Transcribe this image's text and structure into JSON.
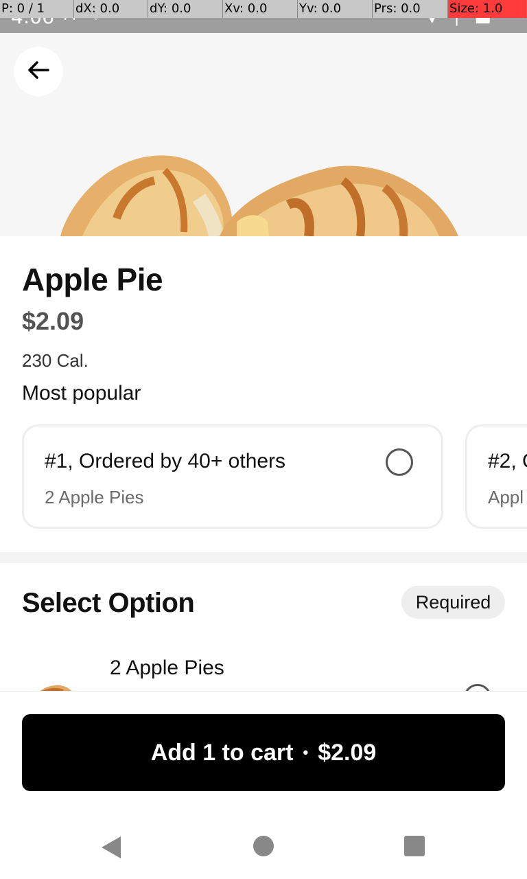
{
  "status_bar": {
    "time": "4:06",
    "left_icons": [
      "gmail-icon",
      "location-icon"
    ],
    "right_icons": [
      "wifi-icon",
      "signal-icon",
      "battery-icon"
    ]
  },
  "debug_overlay": {
    "pointer": "P: 0 / 1",
    "dx": "dX: 0.0",
    "dy": "dY: 0.0",
    "xv": "Xv: 0.0",
    "yv": "Yv: 0.0",
    "prs": "Prs: 0.0",
    "size": "Size: 1.0"
  },
  "hero": {
    "back_icon": "arrow-left-icon",
    "image": "apple-pie-pastries-image"
  },
  "item": {
    "name": "Apple Pie",
    "price": "$2.09",
    "calories": "230 Cal."
  },
  "most_popular": {
    "label": "Most popular",
    "cards": [
      {
        "title": "#1, Ordered by 40+ others",
        "subtitle": "2 Apple Pies",
        "selected": false
      },
      {
        "title": "#2, O",
        "subtitle": "Appl",
        "selected": false
      }
    ]
  },
  "select_option": {
    "title": "Select Option",
    "badge": "Required",
    "options": [
      {
        "label": "2 Apple Pies",
        "selected": false
      }
    ]
  },
  "cart_button": {
    "label": "Add 1 to cart",
    "separator": "•",
    "price": "$2.09"
  },
  "nav_bar": {
    "icons": [
      "nav-back-icon",
      "nav-home-icon",
      "nav-recents-icon"
    ]
  },
  "colors": {
    "status_bar_bg": "#9e9e9e",
    "cart_button_bg": "#000000",
    "badge_bg": "#eeeeee",
    "price_text": "#545454"
  }
}
